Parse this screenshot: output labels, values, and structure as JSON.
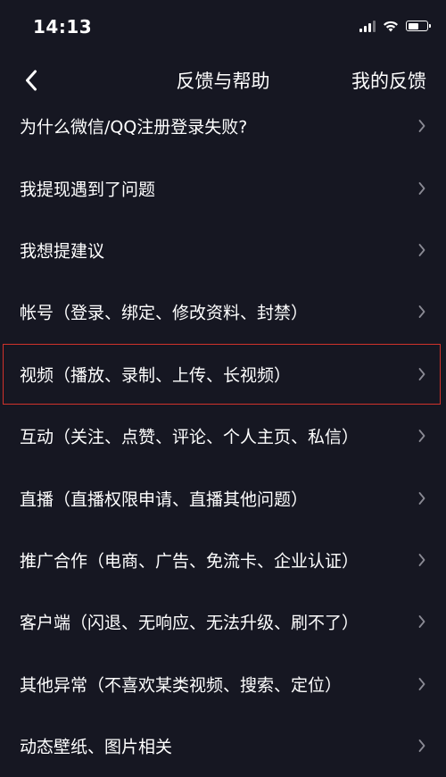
{
  "status_bar": {
    "time": "14:13",
    "icons": [
      "signal-icon",
      "wifi-icon",
      "battery-icon"
    ],
    "battery_level": 0.6
  },
  "nav": {
    "back_icon": "chevron-left-icon",
    "title": "反馈与帮助",
    "action": "我的反馈"
  },
  "list": {
    "items": [
      {
        "label": "为什么微信/QQ注册登录失败?"
      },
      {
        "label": "我提现遇到了问题"
      },
      {
        "label": "我想提建议"
      },
      {
        "label": "帐号（登录、绑定、修改资料、封禁）"
      },
      {
        "label": "视频（播放、录制、上传、长视频）",
        "highlighted": true
      },
      {
        "label": "互动（关注、点赞、评论、个人主页、私信）"
      },
      {
        "label": "直播（直播权限申请、直播其他问题）"
      },
      {
        "label": "推广合作（电商、广告、免流卡、企业认证）"
      },
      {
        "label": "客户端（闪退、无响应、无法升级、刷不了）"
      },
      {
        "label": "其他异常（不喜欢某类视频、搜索、定位）"
      },
      {
        "label": "动态壁纸、图片相关"
      }
    ],
    "item_icon": "chevron-right-icon"
  },
  "colors": {
    "background": "#161722",
    "text": "#ffffff",
    "chevron": "#8a8a94",
    "highlight_border": "#d0322b"
  }
}
